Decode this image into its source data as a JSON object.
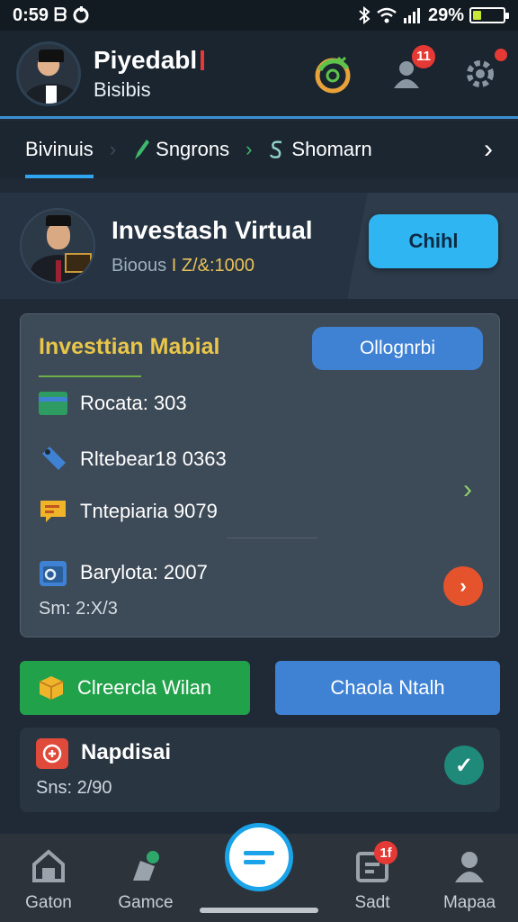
{
  "status_bar": {
    "time": "0:59",
    "left_glyph": "ᗷ",
    "battery_percent": "29%",
    "battery_level": 0.29,
    "icons": [
      "bluetooth-icon",
      "wifi-icon",
      "signal-icon",
      "battery-icon"
    ]
  },
  "header": {
    "name": "Piyedabl",
    "subtitle": "Bisibis",
    "notification_badge": "11"
  },
  "tabs": [
    {
      "label": "Bivinuis"
    },
    {
      "label": "Sngrons"
    },
    {
      "label": "Shomarn"
    }
  ],
  "profile": {
    "title": "Investash Virtual",
    "subtitle_prefix": "Bioous",
    "amount": "I Z/&:1000",
    "button": "Chihl"
  },
  "panel": {
    "title": "Investtian Mabial",
    "button": "Ollognrbi",
    "rows": [
      {
        "icon": "card-icon",
        "label": "Rocata: 303",
        "color": "#2e9c62"
      },
      {
        "icon": "tag-icon",
        "label": "Rltebear18 0363",
        "color": "#3f82d4"
      },
      {
        "icon": "chat-icon",
        "label": "Tntepiaria 9079",
        "color": "#f0b42b"
      },
      {
        "icon": "calendar-icon",
        "label": "Barylota: 2007",
        "color": "#3f82d4"
      }
    ],
    "footer": "Sm: 2:X/3"
  },
  "actions": {
    "green_button": "Clreercla Wilan",
    "blue_button": "Chaola Ntalh"
  },
  "notification_card": {
    "title": "Napdisai",
    "subtitle": "Sns: 2/90"
  },
  "bottom_nav": [
    {
      "label": "Gaton",
      "icon": "home-icon"
    },
    {
      "label": "Gamce",
      "icon": "game-icon"
    },
    {
      "label": "",
      "icon": "menu-icon"
    },
    {
      "label": "Sadt",
      "icon": "store-icon",
      "badge": "1f"
    },
    {
      "label": "Mapaa",
      "icon": "user-icon"
    }
  ],
  "colors": {
    "accent_blue": "#2fb5f2",
    "panel_title": "#e9c64a",
    "green": "#21a24a",
    "badge_red": "#e53935"
  }
}
